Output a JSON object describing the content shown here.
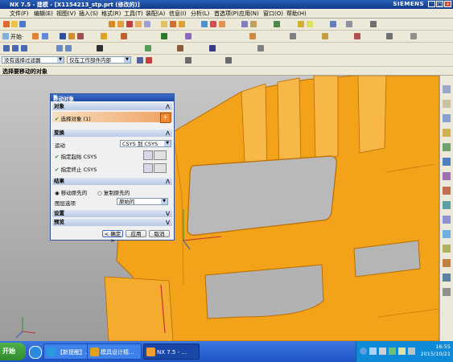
{
  "window": {
    "title": "NX 7.5 - 建模 - [X1154213_stp.prt (修改的)]",
    "brand": "SIEMENS"
  },
  "menu": [
    "文件(F)",
    "编辑(E)",
    "视图(V)",
    "插入(S)",
    "格式(R)",
    "工具(T)",
    "装配(A)",
    "信息(I)",
    "分析(L)",
    "首选项(P)",
    "应用(N)",
    "窗口(O)",
    "帮助(H)"
  ],
  "toolbar": {
    "start_label": "开始·",
    "filter_value": "没有选择过滤器",
    "scope_value": "仅在工作部件内部"
  },
  "prompt": "选择要移动的对象",
  "dialog": {
    "title": "移动对象",
    "section_object": "对象",
    "select_object": "选择对象 (1)",
    "section_transform": "变换",
    "motion_label": "运动",
    "motion_value": "CSYS 到 CSYS",
    "start_csys": "指定起始 CSYS",
    "end_csys": "指定终止 CSYS",
    "section_result": "结果",
    "move_original": "移动原先的",
    "copy_original": "复制原先的",
    "layer_label": "图层选项",
    "layer_value": "原始的",
    "section_settings": "设置",
    "section_preview": "预览",
    "ok": "< 确定 >",
    "apply": "应用",
    "cancel": "取消"
  },
  "taskbar": {
    "start": "开始",
    "tasks": [
      "【新提醒】...",
      "模具设计精...",
      "NX 7.5 - ..."
    ],
    "time": "16:55",
    "date": "2015/10/21"
  },
  "colors": {
    "part": "#f2a31a",
    "part_edge": "#b86b00",
    "accent": "#1c4aa7"
  }
}
